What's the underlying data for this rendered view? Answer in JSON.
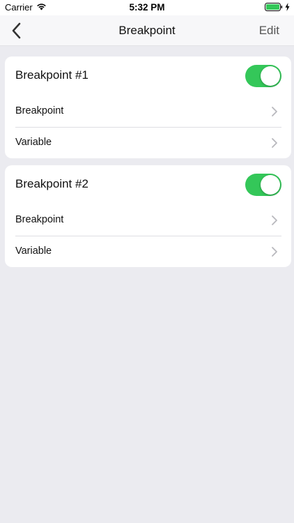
{
  "status": {
    "carrier": "Carrier",
    "time": "5:32 PM"
  },
  "nav": {
    "title": "Breakpoint",
    "edit_label": "Edit",
    "back_icon": "chevron-left-icon"
  },
  "cards": [
    {
      "title": "Breakpoint #1",
      "enabled": true,
      "rows": [
        {
          "label": "Breakpoint"
        },
        {
          "label": "Variable"
        }
      ]
    },
    {
      "title": "Breakpoint #2",
      "enabled": true,
      "rows": [
        {
          "label": "Breakpoint"
        },
        {
          "label": "Variable"
        }
      ]
    }
  ],
  "colors": {
    "toggle_on": "#34c759",
    "background": "#ebebf0",
    "battery": "#34c759"
  }
}
